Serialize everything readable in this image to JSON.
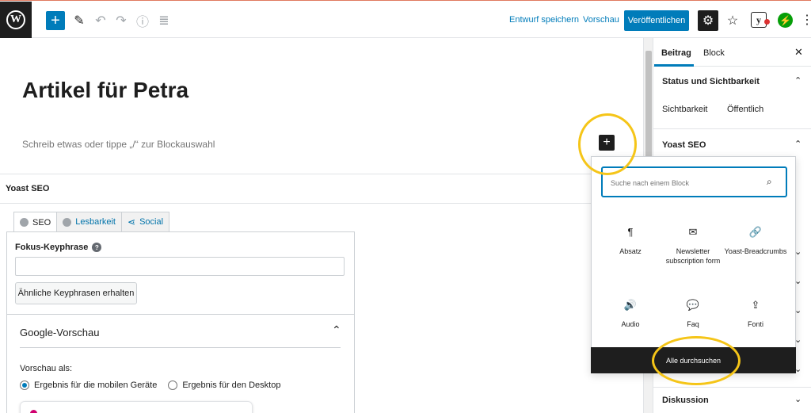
{
  "topbar": {
    "logo": "W",
    "add_block_icon": "+",
    "tools_icon": "✎",
    "undo_icon": "↶",
    "redo_icon": "↷",
    "info_icon": "ⓘ",
    "outline_icon": "≣",
    "save_draft": "Entwurf speichern",
    "preview": "Vorschau",
    "publish": "Veröffentlichen",
    "settings_icon": "⚙",
    "star_icon": "☆",
    "yoast_icon": "y",
    "jetpack_icon": "⚡",
    "more_icon": "⋮"
  },
  "editor": {
    "title": "Artikel für Petra",
    "placeholder": "Schreib etwas oder tippe „/“ zur Blockauswahl",
    "inline_add_icon": "+"
  },
  "yoast": {
    "metabox_title": "Yoast SEO",
    "tabs": [
      {
        "label": "SEO"
      },
      {
        "label": "Lesbarkeit"
      },
      {
        "label": "Social"
      }
    ],
    "focus_keyphrase_label": "Fokus-Keyphrase",
    "help_icon": "?",
    "related_button": "Ähnliche Keyphrasen erhalten",
    "google_preview_title": "Google-Vorschau",
    "collapse_icon": "⌃",
    "preview_as": "Vorschau als:",
    "radio_mobile": "Ergebnis für die mobilen Geräte",
    "radio_desktop": "Ergebnis für den Desktop"
  },
  "sidebar": {
    "tab_post": "Beitrag",
    "tab_block": "Block",
    "close_icon": "✕",
    "status_title": "Status und Sichtbarkeit",
    "visibility_label": "Sichtbarkeit",
    "visibility_value": "Öffentlich",
    "yoast_title": "Yoast SEO",
    "discussion_title": "Diskussion",
    "chevron_up": "⌃",
    "chevron_down": "⌄"
  },
  "inserter": {
    "search_placeholder": "Suche nach einem Block",
    "search_icon": "⌕",
    "blocks": [
      {
        "icon": "¶",
        "label": "Absatz"
      },
      {
        "icon": "✉",
        "label": "Newsletter subscription form"
      },
      {
        "icon": "🔗",
        "label": "Yoast-Breadcrumbs"
      },
      {
        "icon": "🔊",
        "label": "Audio"
      },
      {
        "icon": "💬",
        "label": "Faq"
      },
      {
        "icon": "⇪",
        "label": "Fonti"
      }
    ],
    "browse_all": "Alle durchsuchen"
  },
  "colors": {
    "accent": "#007cba",
    "highlight_circle": "#f5c518",
    "dark": "#1e1e1e"
  }
}
